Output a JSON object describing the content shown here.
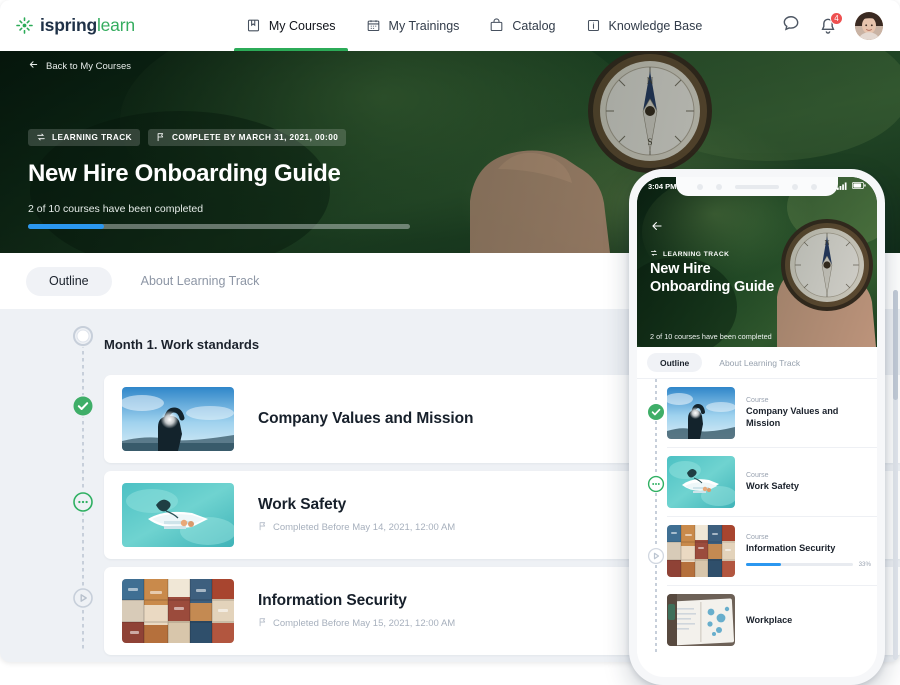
{
  "brand": {
    "name_bold": "ispring",
    "name_light": "learn",
    "logo_icon": "ispring-sparkle-icon",
    "accent_green": "#2cab58",
    "accent_blue": "#2b97f0"
  },
  "topnav": {
    "tabs": [
      {
        "label": "My Courses",
        "icon": "book-icon",
        "active": true
      },
      {
        "label": "My Trainings",
        "icon": "calendar-icon",
        "active": false
      },
      {
        "label": "Catalog",
        "icon": "box-icon",
        "active": false
      },
      {
        "label": "Knowledge Base",
        "icon": "info-icon",
        "active": false
      }
    ],
    "chat_icon": "chat-bubble-icon",
    "bell_icon": "bell-icon",
    "notification_count": "4",
    "avatar_icon": "user-avatar"
  },
  "hero": {
    "back_label": "Back to My Courses",
    "back_icon": "arrow-left-icon",
    "chips": [
      {
        "label": "LEARNING TRACK",
        "icon": "learning-track-icon"
      },
      {
        "label": "COMPLETE BY MARCH 31, 2021, 00:00",
        "icon": "flag-icon"
      }
    ],
    "title": "New Hire Onboarding Guide",
    "progress_text": "2 of 10 courses have been completed",
    "progress_percent": 20
  },
  "tabs": [
    {
      "label": "Outline",
      "active": true
    },
    {
      "label": "About Learning Track",
      "active": false
    }
  ],
  "outline": {
    "section_title": "Month 1. Work standards",
    "section_marker": "empty-circle-icon",
    "items": [
      {
        "title": "Company Values and Mission",
        "meta": "",
        "meta_icon": "",
        "marker": "check-circle-icon",
        "thumb": "hand-sun-photo"
      },
      {
        "title": "Work Safety",
        "meta": "Completed Before May 14, 2021, 12:00 AM",
        "meta_icon": "flag-icon",
        "marker": "in-progress-circle-icon",
        "thumb": "boat-photo"
      },
      {
        "title": "Information Security",
        "meta": "Completed Before May 15, 2021, 12:00 AM",
        "meta_icon": "flag-icon",
        "marker": "play-circle-icon",
        "thumb": "suitcases-photo"
      }
    ]
  },
  "phone": {
    "status_time": "3:04 PM",
    "signal_icon": "signal-bars-icon",
    "battery_icon": "battery-icon",
    "back_icon": "arrow-left-icon",
    "chip_label": "LEARNING TRACK",
    "chip_icon": "learning-track-icon",
    "title_line1": "New Hire",
    "title_line2": "Onboarding Guide",
    "progress_text": "2 of 10 courses have been completed",
    "progress_percent": 20,
    "tabs": [
      {
        "label": "Outline",
        "active": true
      },
      {
        "label": "About Learning Track",
        "active": false
      }
    ],
    "items": [
      {
        "kind": "Course",
        "name": "Company Values and Mission",
        "marker": "check-circle-icon",
        "thumb": "hand-sun-photo",
        "percent": null,
        "percent_label": ""
      },
      {
        "kind": "Course",
        "name": "Work Safety",
        "marker": "in-progress-circle-icon",
        "thumb": "boat-photo",
        "percent": null,
        "percent_label": ""
      },
      {
        "kind": "Course",
        "name": "Information Security",
        "marker": "play-circle-icon",
        "thumb": "suitcases-photo",
        "percent": 33,
        "percent_label": "33%"
      },
      {
        "kind": "",
        "name": "Workplace",
        "marker": "",
        "thumb": "notebook-photo",
        "percent": null,
        "percent_label": ""
      }
    ]
  }
}
